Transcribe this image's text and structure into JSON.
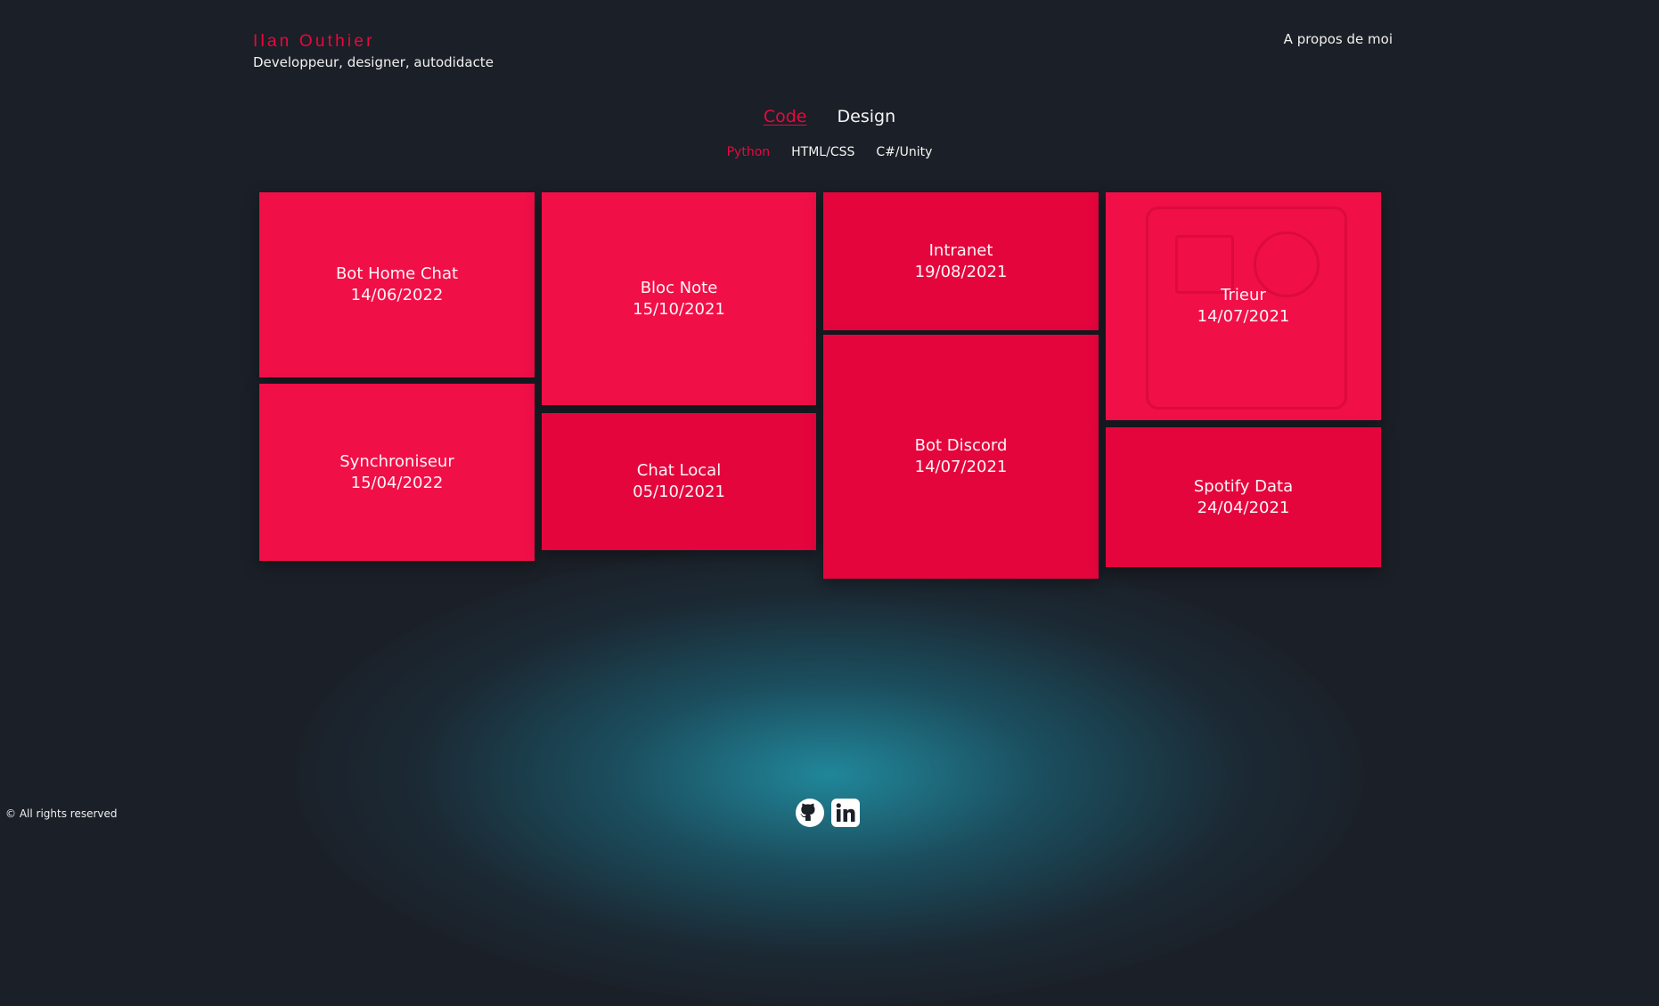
{
  "header": {
    "name": "Ilan Outhier",
    "tagline": "Developpeur, designer, autodidacte",
    "about_link": "A propos de moi"
  },
  "categories": [
    {
      "label": "Code",
      "active": true
    },
    {
      "label": "Design",
      "active": false
    }
  ],
  "subcategories": [
    {
      "label": "Python",
      "active": true
    },
    {
      "label": "HTML/CSS",
      "active": false
    },
    {
      "label": "C#/Unity",
      "active": false
    }
  ],
  "projects": [
    {
      "title": "Bot Home Chat",
      "date": "14/06/2022"
    },
    {
      "title": "Synchroniseur",
      "date": "15/04/2022"
    },
    {
      "title": "Bloc Note",
      "date": "15/10/2021"
    },
    {
      "title": "Chat Local",
      "date": "05/10/2021"
    },
    {
      "title": "Intranet",
      "date": "19/08/2021"
    },
    {
      "title": "Bot Discord",
      "date": "14/07/2021"
    },
    {
      "title": "Trieur",
      "date": "14/07/2021"
    },
    {
      "title": "Spotify Data",
      "date": "24/04/2021"
    }
  ],
  "footer": {
    "copyright": "© All rights reserved",
    "icons": [
      "github-icon",
      "linkedin-icon"
    ]
  },
  "colors": {
    "accent": "#e8083f",
    "background": "#1b1f27",
    "glow": "#1f8ca0"
  }
}
